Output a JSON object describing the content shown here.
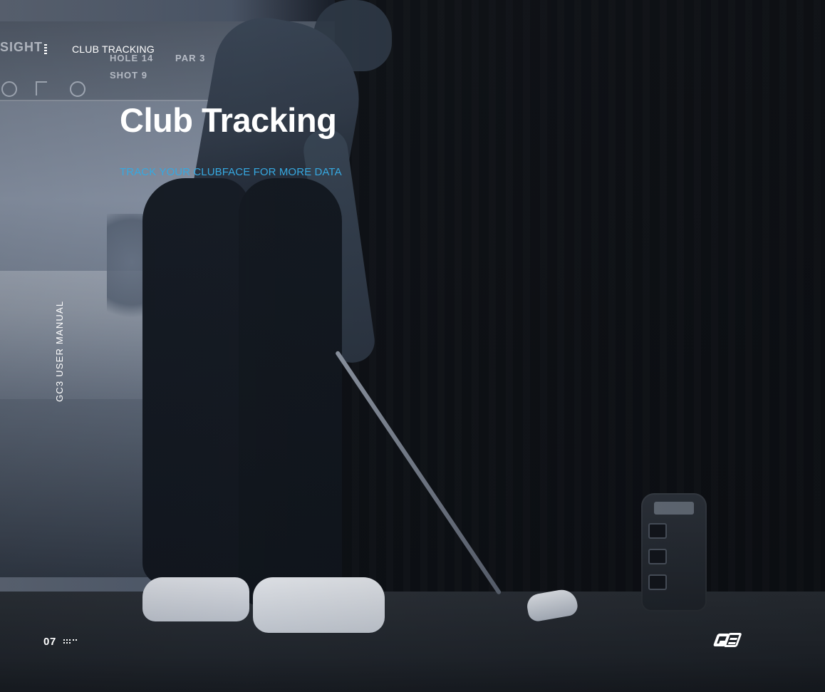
{
  "header": {
    "section_label": "CLUB TRACKING"
  },
  "hero": {
    "title": "Club Tracking",
    "subtitle": "TRACK YOUR CLUBFACE FOR MORE DATA"
  },
  "sidebar": {
    "vertical_label": "GC3 USER MANUAL"
  },
  "footer": {
    "page_number": "07"
  },
  "icons": {
    "menu": "vertical-dots-icon",
    "pagination": "page-dots-icon",
    "brand": "ge-logo-icon"
  },
  "colors": {
    "accent": "#36A8E0",
    "text": "#FFFFFF",
    "background": "#0F1012"
  }
}
